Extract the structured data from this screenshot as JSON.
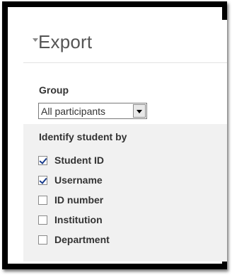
{
  "section": {
    "title": "Export"
  },
  "group": {
    "label": "Group",
    "selected": "All participants"
  },
  "identify": {
    "label": "Identify student by",
    "options": [
      {
        "label": "Student ID",
        "checked": true
      },
      {
        "label": "Username",
        "checked": true
      },
      {
        "label": "ID number",
        "checked": false
      },
      {
        "label": "Institution",
        "checked": false
      },
      {
        "label": "Department",
        "checked": false
      }
    ]
  },
  "colors": {
    "frame": "#000000",
    "identify_background": "#f1f1f1",
    "checkmark": "#1a3d8c"
  }
}
